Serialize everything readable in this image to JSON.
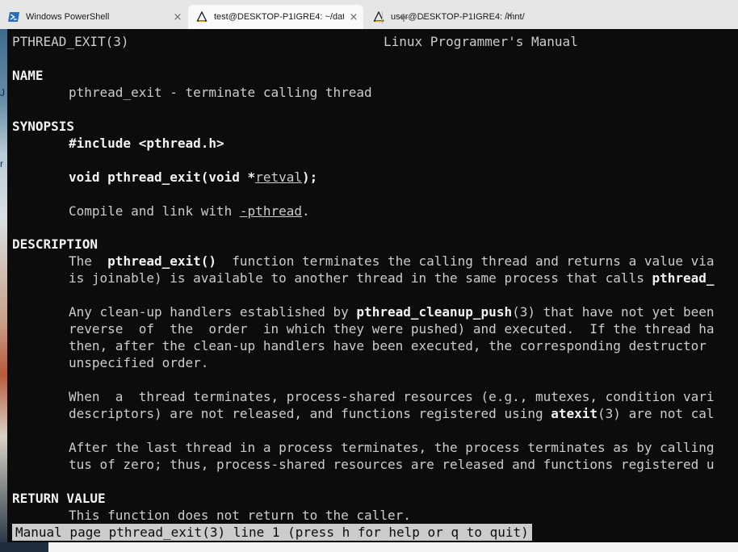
{
  "tabs": [
    {
      "title": "Windows PowerShell",
      "icon": "powershell-icon",
      "active": false
    },
    {
      "title": "test@DESKTOP-P1IGRE4: ~/data",
      "icon": "linux-penguin-icon",
      "active": true
    },
    {
      "title": "user@DESKTOP-P1IGRE4: /mnt/",
      "icon": "linux-penguin-icon",
      "active": false
    }
  ],
  "tab_close_glyph": "×",
  "new_tab_glyph": "+",
  "dropdown_glyph": "∨",
  "desktop_fragments": [
    "J",
    "r"
  ],
  "man": {
    "header_left": "PTHREAD_EXIT(3)",
    "header_center": "Linux Programmer's Manual",
    "name_heading": "NAME",
    "name_text": "pthread_exit - terminate calling thread",
    "synopsis_heading": "SYNOPSIS",
    "synopsis_include": "#include <pthread.h>",
    "synopsis_proto_pre": "void pthread_exit(void *",
    "synopsis_proto_arg": "retval",
    "synopsis_proto_post": ");",
    "synopsis_link_pre": "Compile and link with ",
    "synopsis_link_flag": "-pthread",
    "synopsis_link_post": ".",
    "description_heading": "DESCRIPTION",
    "desc1_l1_pre": "The  ",
    "desc1_l1_fn": "pthread_exit()",
    "desc1_l1_post": "  function terminates the calling thread and returns a value via",
    "desc1_l2_pre": "is joinable) is available to another thread in the same process that calls ",
    "desc1_l2_fn": "pthread_",
    "desc2_l1_pre": "Any clean-up handlers established by ",
    "desc2_l1_fn": "pthread_cleanup_push",
    "desc2_l1_post": "(3) that have not yet been",
    "desc2_l2": "reverse  of  the  order  in which they were pushed) and executed.  If the thread ha",
    "desc2_l3": "then, after the clean-up handlers have been executed, the corresponding destructor",
    "desc2_l4": "unspecified order.",
    "desc3_l1": "When  a  thread terminates, process-shared resources (e.g., mutexes, condition vari",
    "desc3_l2_pre": "descriptors) are not released, and functions registered using ",
    "desc3_l2_fn": "atexit",
    "desc3_l2_post": "(3) are not cal",
    "desc4_l1": "After the last thread in a process terminates, the process terminates as by calling",
    "desc4_l2": "tus of zero; thus, process-shared resources are released and functions registered u",
    "return_heading": "RETURN VALUE",
    "return_text": "This function does not return to the caller."
  },
  "status_line": "Manual page pthread_exit(3) line 1 (press h for help or q to quit)",
  "colors": {
    "terminal_bg": "#0c0c0c",
    "terminal_fg": "#cccccc",
    "bold_fg": "#f2f2f2",
    "tabbar_bg": "#e6e6e6",
    "active_tab_bg": "#f9f9f9",
    "status_bg": "#cccccc"
  }
}
